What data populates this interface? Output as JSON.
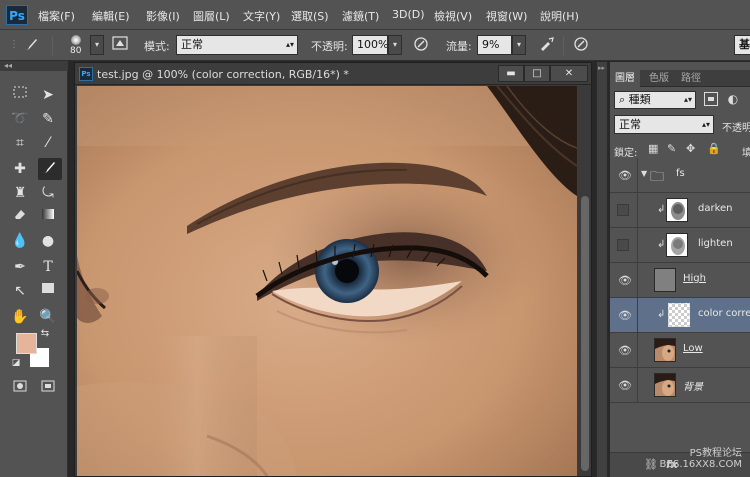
{
  "app": {
    "logo": "Ps"
  },
  "menu": [
    "檔案(F)",
    "編輯(E)",
    "影像(I)",
    "圖層(L)",
    "文字(Y)",
    "選取(S)",
    "濾鏡(T)",
    "3D(D)",
    "檢視(V)",
    "視窗(W)",
    "說明(H)"
  ],
  "options": {
    "brush_size": "80",
    "mode_label": "模式:",
    "mode_value": "正常",
    "opacity_label": "不透明:",
    "opacity_value": "100%",
    "flow_label": "流量:",
    "flow_value": "9%",
    "workspace_partial": "基"
  },
  "document": {
    "title": "test.jpg @ 100% (color correction, RGB/16*) *",
    "ps_icon": "Ps",
    "minimize": "▬",
    "maximize": "□",
    "close": "✕"
  },
  "toolbar": {
    "collapse": "◂◂"
  },
  "colors": {
    "foreground": "#e5b49b",
    "background": "#ffffff",
    "selection": "#5e708a"
  },
  "layers_panel": {
    "tabs": [
      "圖層",
      "色版",
      "路徑"
    ],
    "filter_kind": "⌕ 種類",
    "blend_mode": "正常",
    "opacity_label": "不透明",
    "lock_label": "鎖定:",
    "fill_partial": "填",
    "layers": [
      {
        "name": "fs",
        "type": "group",
        "visible": true
      },
      {
        "name": "darken",
        "type": "clipped",
        "visible": false
      },
      {
        "name": "lighten",
        "type": "clipped",
        "visible": false
      },
      {
        "name": "High",
        "type": "layer",
        "visible": true
      },
      {
        "name": "color correc",
        "type": "clipped",
        "visible": true,
        "selected": true
      },
      {
        "name": "Low",
        "type": "layer",
        "visible": true
      },
      {
        "name": "背景",
        "type": "background",
        "visible": true
      }
    ]
  },
  "watermark": {
    "line1": "PS教程论坛",
    "line2": "BBS.16XX8.COM"
  }
}
